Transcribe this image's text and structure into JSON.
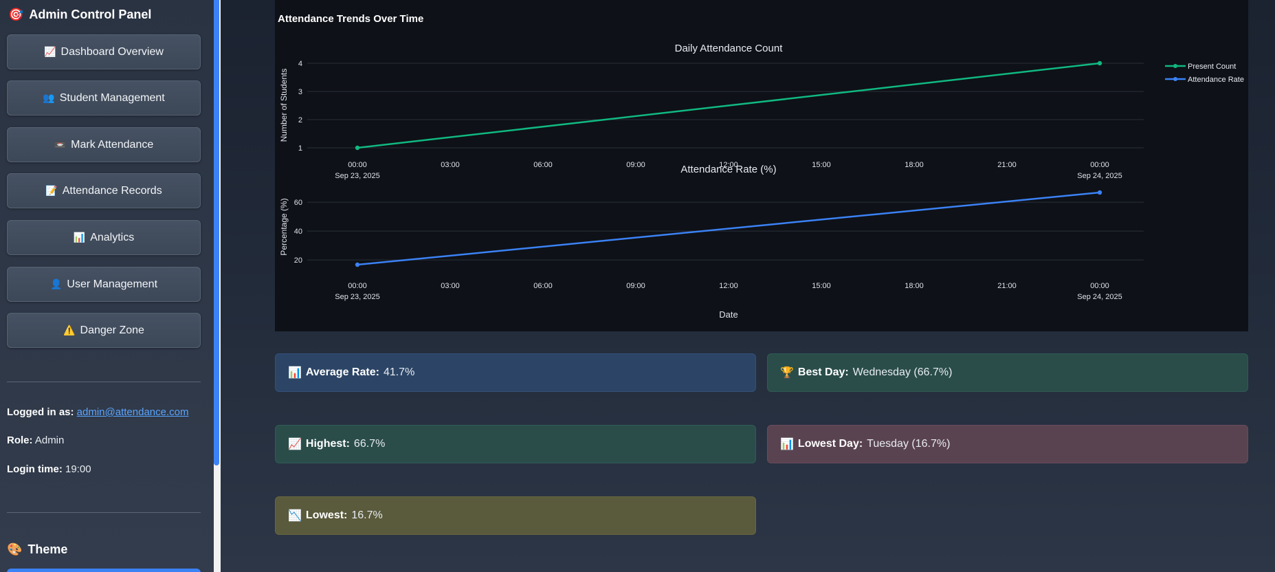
{
  "sidebar": {
    "title": "Admin Control Panel",
    "title_icon": "🎯",
    "nav": [
      {
        "icon": "📈",
        "label": "Dashboard Overview"
      },
      {
        "icon": "👥",
        "label": "Student Management"
      },
      {
        "icon": "📼",
        "label": "Mark Attendance"
      },
      {
        "icon": "📝",
        "label": "Attendance Records"
      },
      {
        "icon": "📊",
        "label": "Analytics"
      },
      {
        "icon": "👤",
        "label": "User Management"
      },
      {
        "icon": "⚠️",
        "label": "Danger Zone"
      }
    ],
    "logged_in_label": "Logged in as:",
    "logged_in_value": "admin@attendance.com",
    "role_label": "Role:",
    "role_value": "Admin",
    "login_time_label": "Login time:",
    "login_time_value": "19:00",
    "theme_icon": "🎨",
    "theme_label": "Theme",
    "accent_color": "#3b82f6"
  },
  "chart_data": {
    "type": "line",
    "title": "Attendance Trends Over Time",
    "xlabel": "Date",
    "x": [
      "2025-09-23 00:00",
      "2025-09-24 00:00"
    ],
    "x_ticks": [
      {
        "time": "00:00",
        "date": "Sep 23, 2025"
      },
      {
        "time": "03:00",
        "date": ""
      },
      {
        "time": "06:00",
        "date": ""
      },
      {
        "time": "09:00",
        "date": ""
      },
      {
        "time": "12:00",
        "date": ""
      },
      {
        "time": "15:00",
        "date": ""
      },
      {
        "time": "18:00",
        "date": ""
      },
      {
        "time": "21:00",
        "date": ""
      },
      {
        "time": "00:00",
        "date": "Sep 24, 2025"
      }
    ],
    "legend_position": "top-right",
    "grid": true,
    "subplots": [
      {
        "title": "Daily Attendance Count",
        "ylabel": "Number of Students",
        "ylim": [
          1,
          4
        ],
        "yticks": [
          1,
          2,
          3,
          4
        ],
        "series": [
          {
            "name": "Present Count",
            "color": "#10b981",
            "values": [
              1,
              4
            ]
          }
        ]
      },
      {
        "title": "Attendance Rate (%)",
        "ylabel": "Percentage (%)",
        "ylim": [
          16.7,
          66.7
        ],
        "yticks": [
          20,
          40,
          60
        ],
        "series": [
          {
            "name": "Attendance Rate",
            "color": "#3b82f6",
            "values": [
              16.7,
              66.7
            ]
          }
        ]
      }
    ]
  },
  "stats": {
    "average": {
      "icon": "📊",
      "label": "Average Rate:",
      "value": "41.7%"
    },
    "best": {
      "icon": "🏆",
      "label": "Best Day:",
      "value": "Wednesday (66.7%)"
    },
    "highest": {
      "icon": "📈",
      "label": "Highest:",
      "value": "66.7%"
    },
    "lowest_day": {
      "icon": "📊",
      "label": "Lowest Day:",
      "value": "Tuesday (16.7%)"
    },
    "lowest": {
      "icon": "📉",
      "label": "Lowest:",
      "value": "16.7%"
    }
  }
}
